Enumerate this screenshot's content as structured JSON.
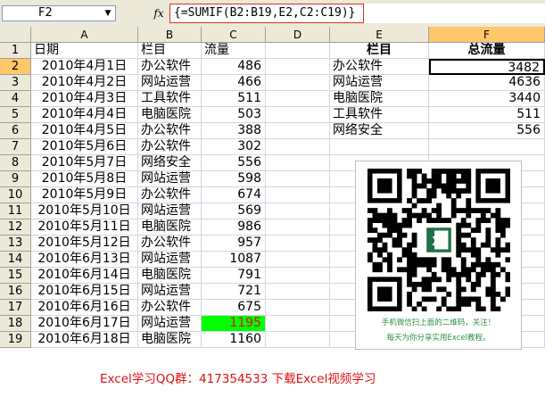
{
  "namebox": {
    "value": "F2"
  },
  "formula_bar": {
    "fx_label": "fx",
    "formula": "{=SUMIF(B2:B19,E2,C2:C19)}"
  },
  "columns": [
    "A",
    "B",
    "C",
    "D",
    "E",
    "F"
  ],
  "header_row": {
    "date": "日期",
    "category": "栏目",
    "flow": "流量"
  },
  "rows": [
    {
      "date": "2010年4月1日",
      "category": "办公软件",
      "flow": "486"
    },
    {
      "date": "2010年4月2日",
      "category": "网站运营",
      "flow": "466"
    },
    {
      "date": "2010年4月3日",
      "category": "工具软件",
      "flow": "511"
    },
    {
      "date": "2010年4月4日",
      "category": "电脑医院",
      "flow": "503"
    },
    {
      "date": "2010年4月5日",
      "category": "办公软件",
      "flow": "388"
    },
    {
      "date": "2010年5月6日",
      "category": "办公软件",
      "flow": "302"
    },
    {
      "date": "2010年5月7日",
      "category": "网络安全",
      "flow": "556"
    },
    {
      "date": "2010年5月8日",
      "category": "网站运营",
      "flow": "598"
    },
    {
      "date": "2010年5月9日",
      "category": "办公软件",
      "flow": "674"
    },
    {
      "date": "2010年5月10日",
      "category": "网站运营",
      "flow": "569"
    },
    {
      "date": "2010年5月11日",
      "category": "电脑医院",
      "flow": "986"
    },
    {
      "date": "2010年5月12日",
      "category": "办公软件",
      "flow": "957"
    },
    {
      "date": "2010年6月13日",
      "category": "网站运营",
      "flow": "1087"
    },
    {
      "date": "2010年6月14日",
      "category": "电脑医院",
      "flow": "791"
    },
    {
      "date": "2010年6月15日",
      "category": "网站运营",
      "flow": "721"
    },
    {
      "date": "2010年6月16日",
      "category": "办公软件",
      "flow": "675"
    },
    {
      "date": "2010年6月17日",
      "category": "网站运营",
      "flow": "1195"
    },
    {
      "date": "2010年6月18日",
      "category": "电脑医院",
      "flow": "1160"
    }
  ],
  "summary": {
    "header_category": "栏目",
    "header_total": "总流量",
    "items": [
      {
        "category": "办公软件",
        "total": "3482"
      },
      {
        "category": "网站运营",
        "total": "4636"
      },
      {
        "category": "电脑医院",
        "total": "3440"
      },
      {
        "category": "工具软件",
        "total": "511"
      },
      {
        "category": "网络安全",
        "total": "556"
      }
    ]
  },
  "qr": {
    "caption_line1": "手机微信扫上面的二维码，关注！",
    "caption_line2": "每天为你分享实用Excel教程。"
  },
  "bottom_note": "Excel学习QQ群：417354533   下载Excel视频学习",
  "colors": {
    "highlight_fill": "#00ff00",
    "highlight_text": "#e01010",
    "formula_border": "#e0301e",
    "active_header": "#ffc76a"
  }
}
